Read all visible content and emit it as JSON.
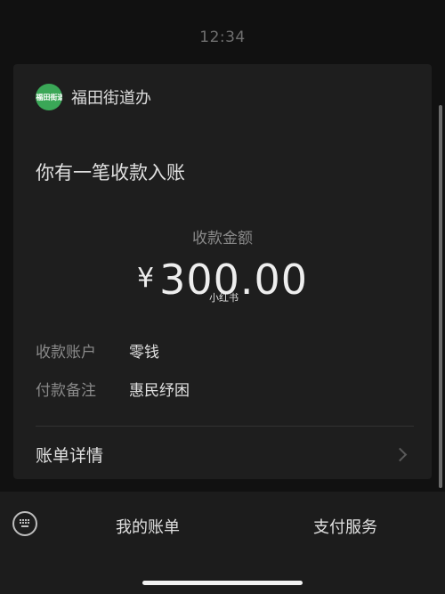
{
  "status": {
    "time": "12:34"
  },
  "card": {
    "avatar_text": "i福田街道",
    "sender": "福田街道办",
    "headline": "你有一笔收款入账",
    "amount_label": "收款金额",
    "currency_symbol": "¥",
    "amount": "300.00",
    "watermark": "小红书",
    "rows": [
      {
        "label": "收款账户",
        "value": "零钱"
      },
      {
        "label": "付款备注",
        "value": "惠民纾困"
      }
    ],
    "detail_label": "账单详情"
  },
  "bottom_bar": {
    "menu": [
      {
        "label": "我的账单"
      },
      {
        "label": "支付服务"
      }
    ]
  },
  "icons": {
    "keyboard": "keyboard-icon",
    "chevron": "chevron-right-icon",
    "avatar": "avatar"
  },
  "colors": {
    "background": "#111111",
    "card": "#1e1e1e",
    "avatar": "#3aa757"
  }
}
